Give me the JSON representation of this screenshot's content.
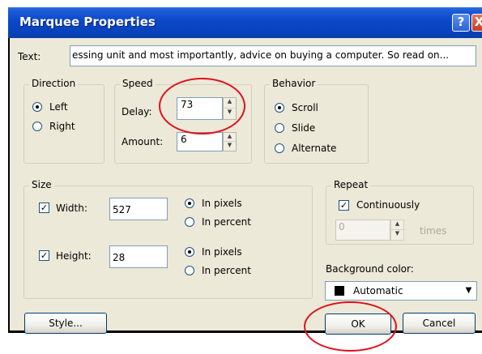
{
  "window": {
    "title": "Marquee Properties"
  },
  "titlebar_buttons": {
    "help": "?",
    "close": "X"
  },
  "text_field": {
    "label": "Text:",
    "value": "essing unit and most importantly, advice on buying a computer. So read on..."
  },
  "direction": {
    "legend": "Direction",
    "options": [
      "Left",
      "Right"
    ],
    "selected": "Left"
  },
  "speed": {
    "legend": "Speed",
    "delay_label": "Delay:",
    "delay_value": "73",
    "amount_label": "Amount:",
    "amount_value": "6"
  },
  "behavior": {
    "legend": "Behavior",
    "options": [
      "Scroll",
      "Slide",
      "Alternate"
    ],
    "selected": "Scroll"
  },
  "size": {
    "legend": "Size",
    "width_label": "Width:",
    "width_value": "527",
    "width_checked": true,
    "width_units": [
      "In pixels",
      "In percent"
    ],
    "width_unit_selected": "In pixels",
    "height_label": "Height:",
    "height_value": "28",
    "height_checked": true,
    "height_units": [
      "In pixels",
      "In percent"
    ],
    "height_unit_selected": "In pixels"
  },
  "repeat": {
    "legend": "Repeat",
    "continuously_label": "Continuously",
    "continuously_checked": true,
    "times_value": "0",
    "times_label": "times"
  },
  "background_color": {
    "label": "Background color:",
    "value": "Automatic",
    "swatch_color": "#000000"
  },
  "buttons": {
    "style": "Style...",
    "ok": "OK",
    "cancel": "Cancel"
  },
  "annotation_color": "#e0101a"
}
